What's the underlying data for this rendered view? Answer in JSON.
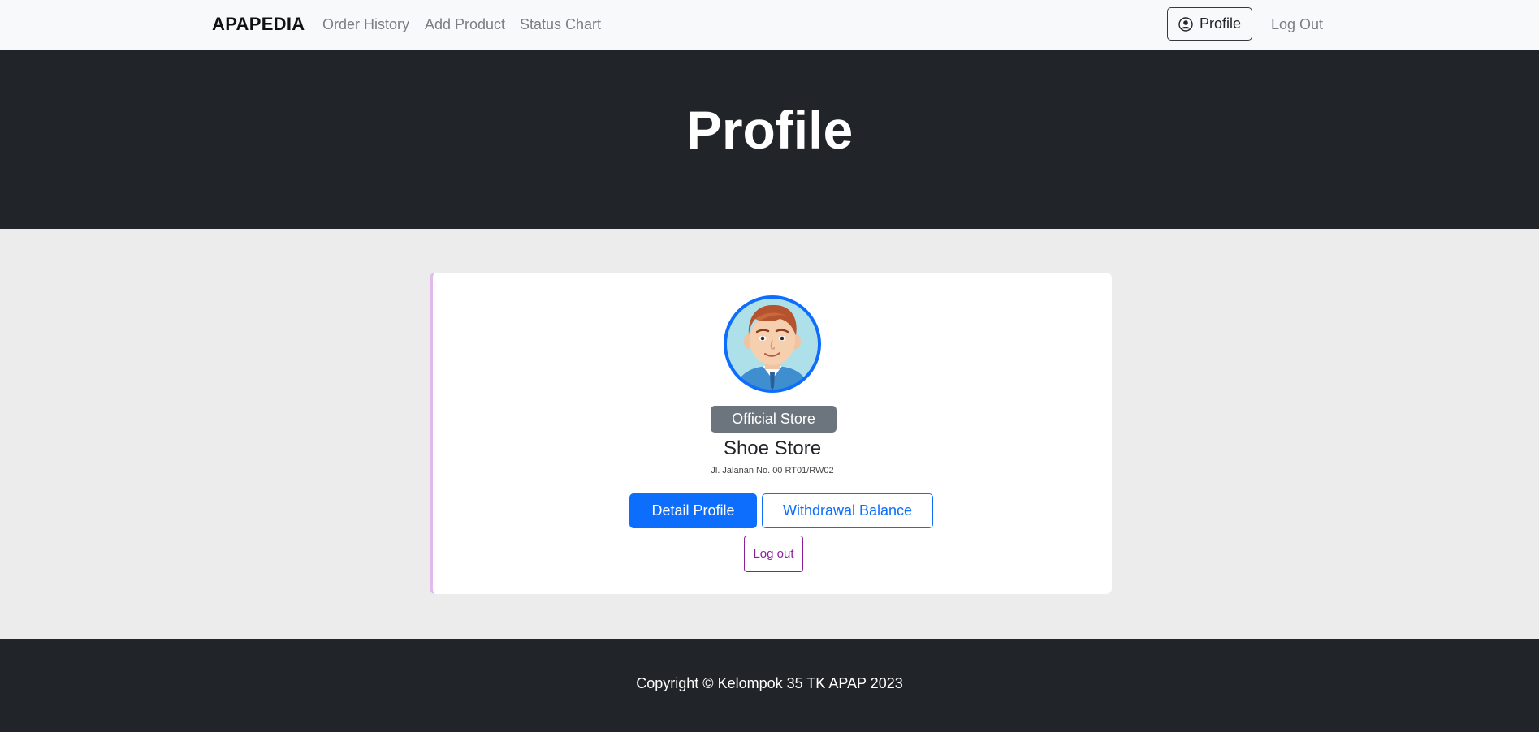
{
  "navbar": {
    "brand": "APAPEDIA",
    "links": [
      {
        "label": "Order History"
      },
      {
        "label": "Add Product"
      },
      {
        "label": "Status Chart"
      }
    ],
    "profile_label": "Profile",
    "profile_icon": "user-circle-icon",
    "logout_label": "Log Out"
  },
  "hero": {
    "title": "Profile"
  },
  "profile_card": {
    "avatar_icon": "cartoon-man-avatar",
    "badge": "Official Store",
    "store_name": "Shoe Store",
    "address": "Jl. Jalanan No. 00 RT01/RW02",
    "detail_button": "Detail Profile",
    "withdraw_button": "Withdrawal Balance",
    "logout_button": "Log out"
  },
  "footer": {
    "copyright": "Copyright © Kelompok 35 TK APAP 2023"
  },
  "colors": {
    "primary": "#0d6efd",
    "dark": "#212529",
    "secondary": "#6c757d",
    "logout_purple": "#8b1f9a",
    "card_accent": "#e3b9ee"
  }
}
